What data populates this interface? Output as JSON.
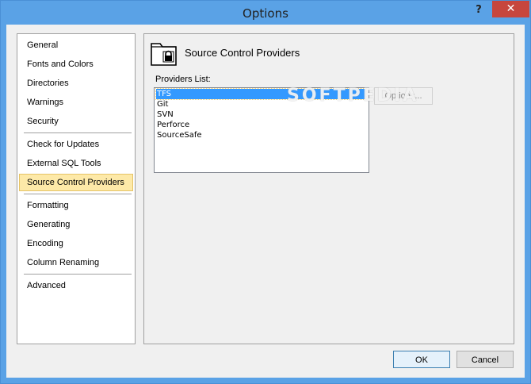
{
  "window": {
    "title": "Options",
    "help_glyph": "?",
    "close_glyph": "✕"
  },
  "nav": {
    "items": [
      {
        "label": "General"
      },
      {
        "label": "Fonts and Colors"
      },
      {
        "label": "Directories"
      },
      {
        "label": "Warnings"
      },
      {
        "label": "Security"
      },
      {
        "label": "Check for Updates"
      },
      {
        "label": "External SQL Tools"
      },
      {
        "label": "Source Control Providers",
        "selected": true
      },
      {
        "label": "Formatting"
      },
      {
        "label": "Generating"
      },
      {
        "label": "Encoding"
      },
      {
        "label": "Column Renaming"
      },
      {
        "label": "Advanced"
      }
    ]
  },
  "page": {
    "title": "Source Control Providers",
    "icon": "folder-lock-icon",
    "providers_label": "Providers List:",
    "providers": [
      "TFS",
      "Git",
      "SVN",
      "Perforce",
      "SourceSafe"
    ],
    "selected_provider": "TFS",
    "options_button": "Options...",
    "watermark": "SOFTPEDIA"
  },
  "footer": {
    "ok_label": "OK",
    "cancel_label": "Cancel"
  },
  "colors": {
    "selection_blue": "#3399ff",
    "nav_selected": "#fde9a8",
    "titlebar": "#5aa2e6",
    "close_red": "#c7463d"
  }
}
